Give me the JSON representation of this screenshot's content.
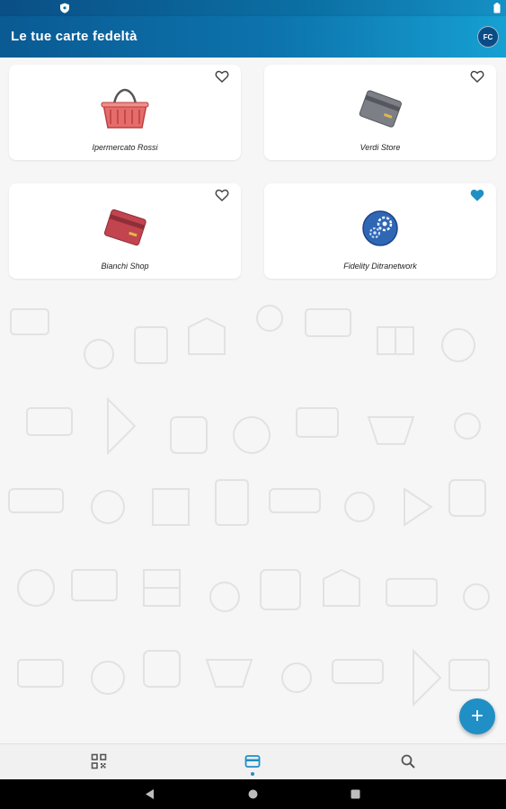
{
  "status_bar": {
    "icons": [
      "shield-icon",
      "battery-icon"
    ]
  },
  "app_bar": {
    "title": "Le tue carte fedeltà",
    "avatar_initials": "FC"
  },
  "cards": [
    {
      "name": "Ipermercato Rossi",
      "image": "shopping-basket-icon",
      "favorite": false
    },
    {
      "name": "Verdi Store",
      "image": "credit-card-gray-icon",
      "favorite": false
    },
    {
      "name": "Bianchi Shop",
      "image": "credit-card-red-icon",
      "favorite": false
    },
    {
      "name": "Fidelity Ditranetwork",
      "image": "gears-logo-icon",
      "favorite": true
    }
  ],
  "fab": {
    "label": "+"
  },
  "bottom_nav": {
    "items": [
      "qr-code-icon",
      "card-icon",
      "search-icon"
    ],
    "selected_index": 1
  },
  "system_nav": [
    "back-icon",
    "home-icon",
    "recents-icon"
  ],
  "colors": {
    "accent": "#1f8fc6",
    "app_bar_start": "#0a5a93",
    "app_bar_end": "#16a0d2"
  }
}
